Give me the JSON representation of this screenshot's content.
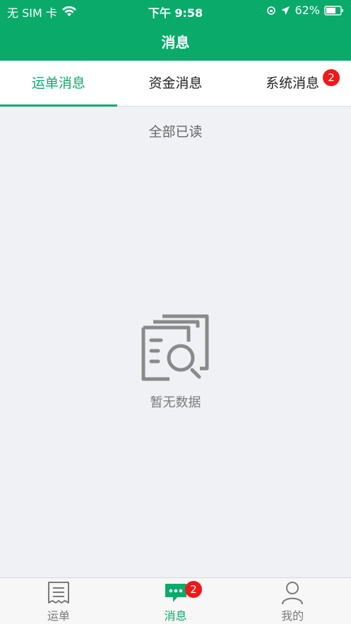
{
  "status_bar": {
    "carrier": "无 SIM 卡",
    "time": "下午 9:58",
    "battery": "62%"
  },
  "nav": {
    "title": "消息"
  },
  "tabs": [
    {
      "label": "运单消息",
      "active": true
    },
    {
      "label": "资金消息",
      "active": false
    },
    {
      "label": "系统消息",
      "active": false,
      "badge": "2"
    }
  ],
  "actions": {
    "mark_all_read": "全部已读"
  },
  "empty_state": {
    "text": "暂无数据"
  },
  "bottom_nav": [
    {
      "label": "运单",
      "icon": "waybill-icon"
    },
    {
      "label": "消息",
      "icon": "message-icon",
      "badge": "2",
      "active": true
    },
    {
      "label": "我的",
      "icon": "profile-icon"
    }
  ],
  "colors": {
    "primary": "#0aaa6b",
    "badge": "#f01818",
    "background": "#f0f1f5"
  }
}
